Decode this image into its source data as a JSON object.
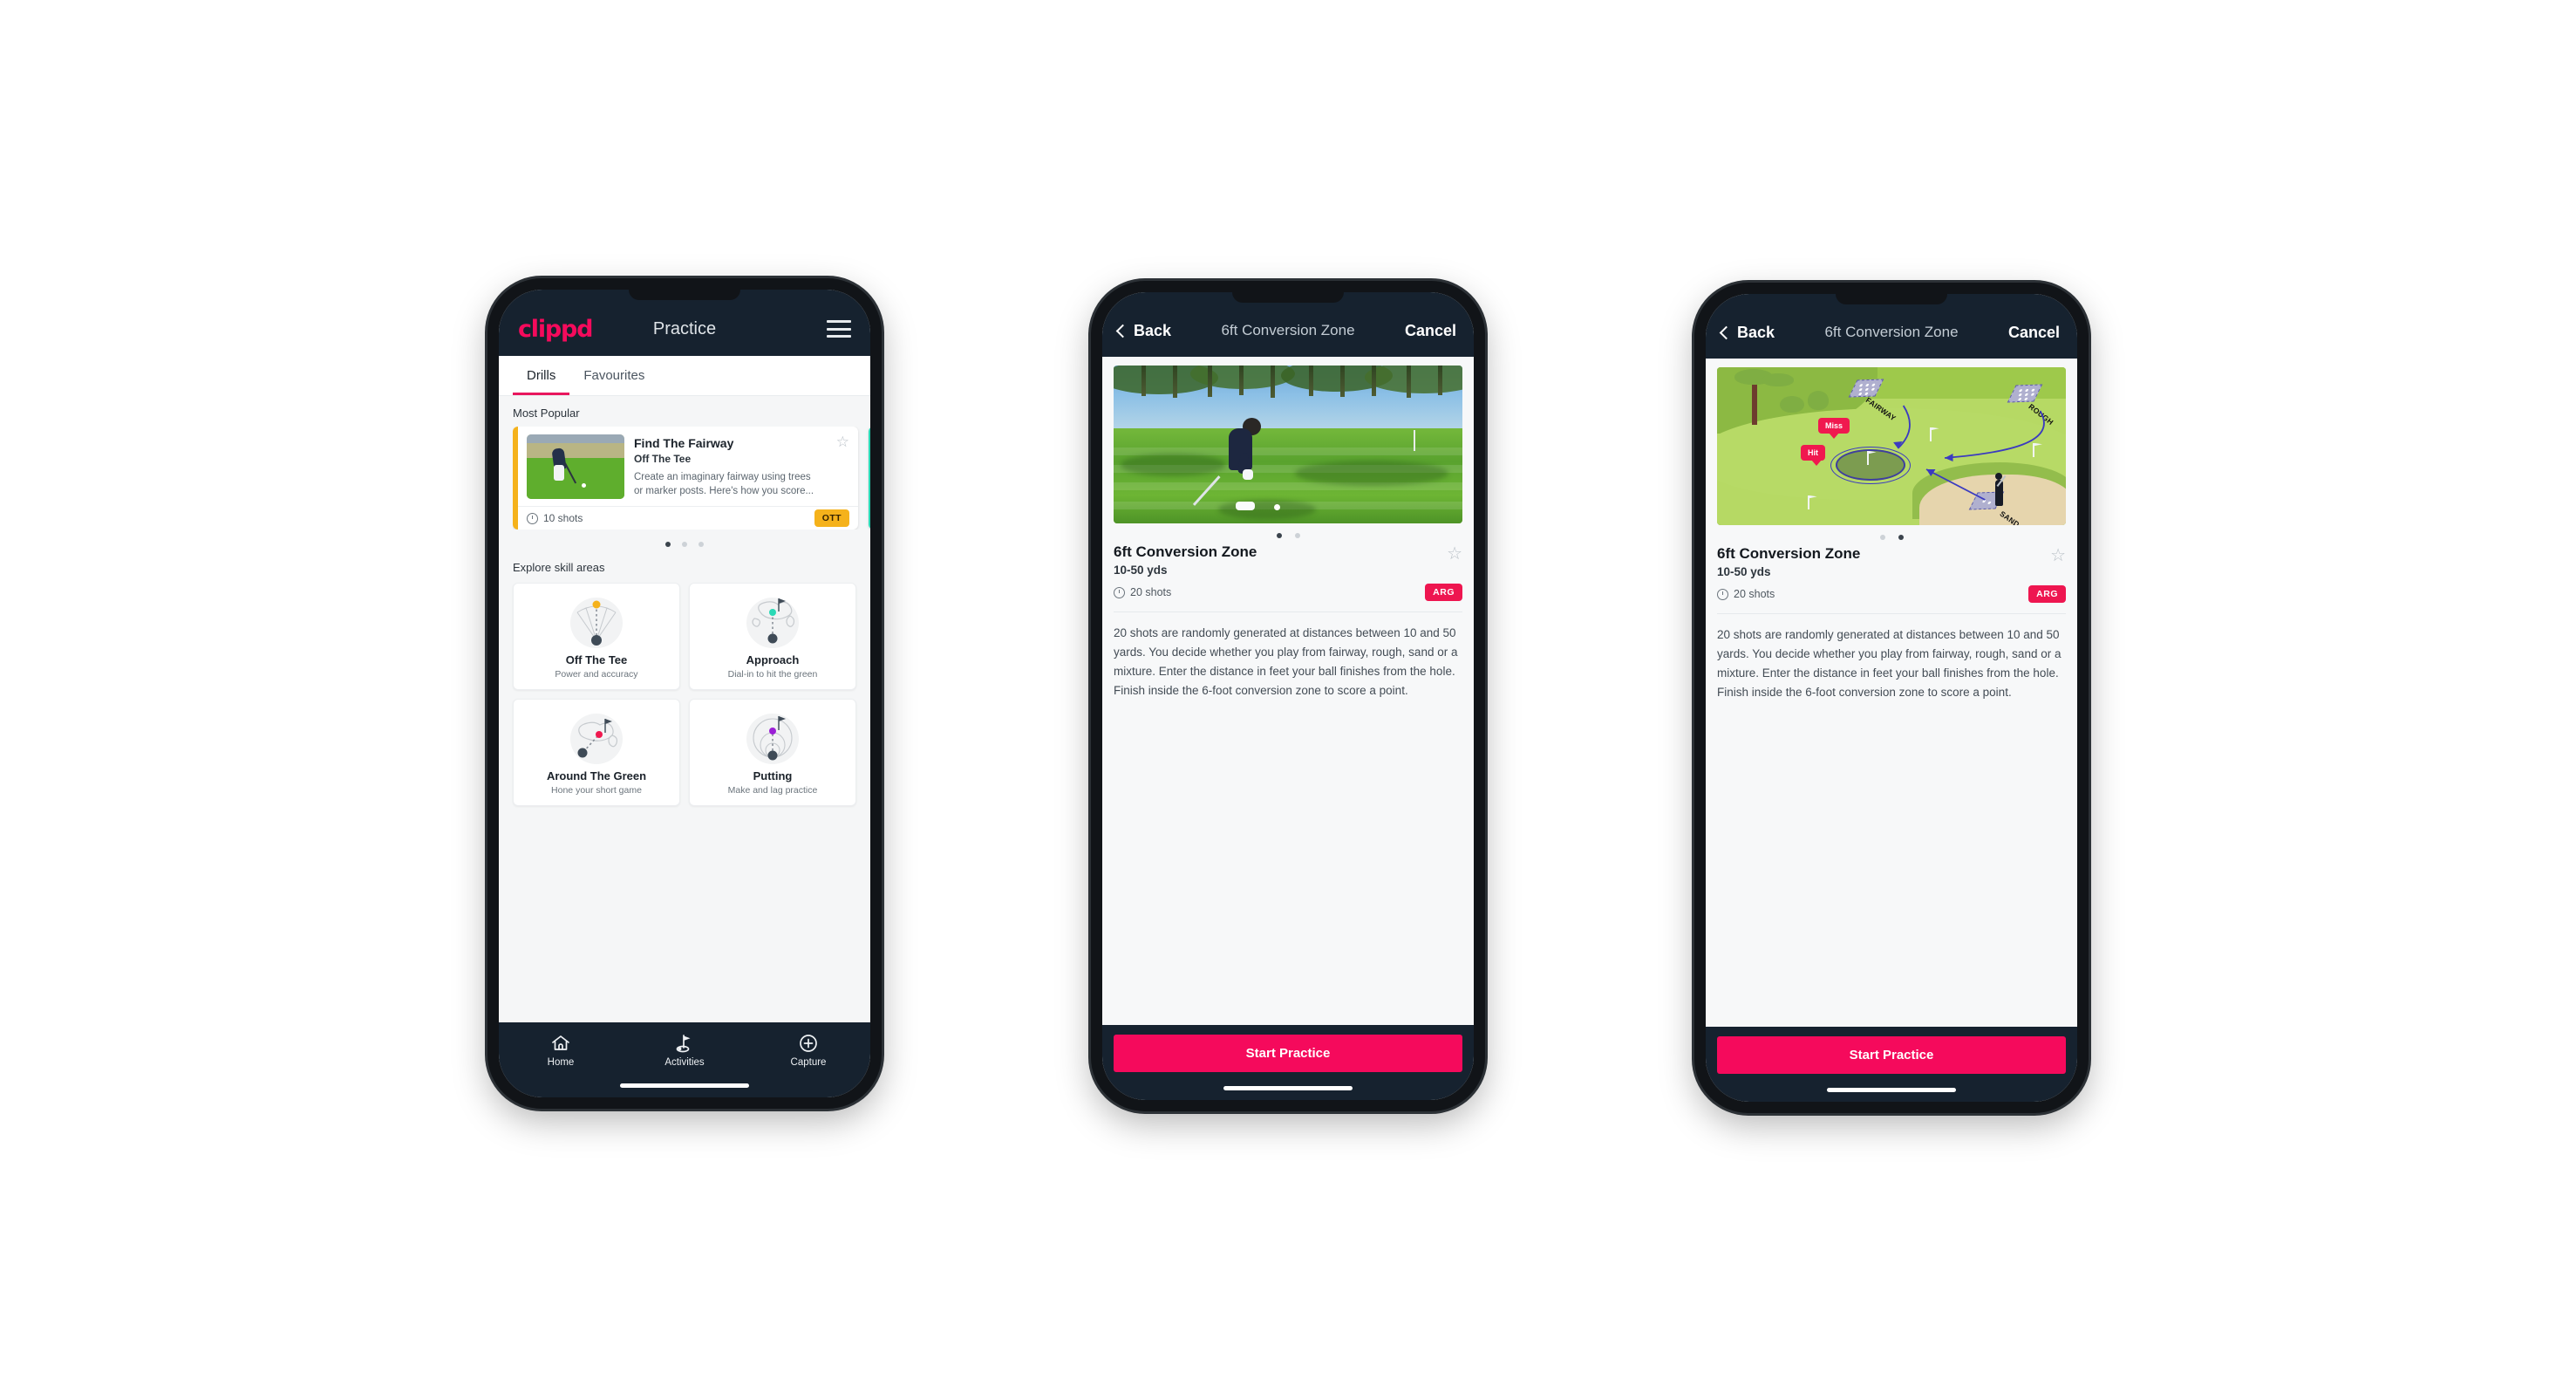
{
  "phone1": {
    "appbar": {
      "logo": "clippd",
      "title": "Practice",
      "menu_icon": "hamburger-menu-icon"
    },
    "tabs": [
      {
        "label": "Drills",
        "active": true
      },
      {
        "label": "Favourites",
        "active": false
      }
    ],
    "most_popular": {
      "heading": "Most Popular",
      "cards": [
        {
          "name": "Find The Fairway",
          "category": "Off The Tee",
          "description": "Create an imaginary fairway using trees or marker posts. Here's how you score...",
          "shots": "10 shots",
          "tag": "OTT",
          "accent": "#f5b21b",
          "tag_bg": "#f5b21b"
        }
      ],
      "dots": [
        true,
        false,
        false
      ]
    },
    "explore": {
      "heading": "Explore skill areas",
      "cards": [
        {
          "name": "Off The Tee",
          "subtitle": "Power and accuracy",
          "icon": "off-the-tee-icon",
          "accent": "#f5b21b"
        },
        {
          "name": "Approach",
          "subtitle": "Dial-in to hit the green",
          "icon": "approach-icon",
          "accent": "#2ad9b6"
        },
        {
          "name": "Around The Green",
          "subtitle": "Hone your short game",
          "icon": "around-the-green-icon",
          "accent": "#f0194f"
        },
        {
          "name": "Putting",
          "subtitle": "Make and lag practice",
          "icon": "putting-icon",
          "accent": "#9b1fd6"
        }
      ]
    },
    "bottom_nav": [
      {
        "label": "Home",
        "icon": "home-icon",
        "active": false
      },
      {
        "label": "Activities",
        "icon": "golf-flag-icon",
        "active": true
      },
      {
        "label": "Capture",
        "icon": "plus-circle-icon",
        "active": false
      }
    ]
  },
  "phone2": {
    "navbar": {
      "back": "Back",
      "title": "6ft Conversion Zone",
      "cancel": "Cancel",
      "back_icon": "chevron-left-icon"
    },
    "media": {
      "type": "photo",
      "alt": "golfer-chipping-photo"
    },
    "dots": [
      true,
      false
    ],
    "detail": {
      "title": "6ft Conversion Zone",
      "yardage": "10-50 yds",
      "shots": "20 shots",
      "tag": "ARG",
      "tag_color": "#ee1650",
      "favourite_icon": "star-outline-icon",
      "description": "20 shots are randomly generated at distances between 10 and 50 yards. You decide whether you play from fairway, rough, sand or a mixture. Enter the distance in feet your ball finishes from the hole. Finish inside the 6-foot conversion zone to score a point."
    },
    "cta": {
      "label": "Start Practice",
      "color": "#f50a5c"
    }
  },
  "phone3": {
    "navbar": {
      "back": "Back",
      "title": "6ft Conversion Zone",
      "cancel": "Cancel",
      "back_icon": "chevron-left-icon"
    },
    "media": {
      "type": "diagram",
      "alt": "golf-course-conversion-zone-diagram",
      "labels": [
        "FAIRWAY",
        "ROUGH",
        "SAND"
      ],
      "callouts": [
        "Miss",
        "Hit"
      ]
    },
    "dots": [
      false,
      true
    ],
    "detail": {
      "title": "6ft Conversion Zone",
      "yardage": "10-50 yds",
      "shots": "20 shots",
      "tag": "ARG",
      "tag_color": "#ee1650",
      "favourite_icon": "star-outline-icon",
      "description": "20 shots are randomly generated at distances between 10 and 50 yards. You decide whether you play from fairway, rough, sand or a mixture. Enter the distance in feet your ball finishes from the hole. Finish inside the 6-foot conversion zone to score a point."
    },
    "cta": {
      "label": "Start Practice",
      "color": "#f50a5c"
    }
  },
  "theme": {
    "brand_pink": "#f50a5c",
    "dark_navy": "#16222f",
    "tab_underline": "#e8175d",
    "ott_yellow": "#f5b21b",
    "arg_pink": "#ee1650",
    "teal": "#2ad9b6"
  }
}
